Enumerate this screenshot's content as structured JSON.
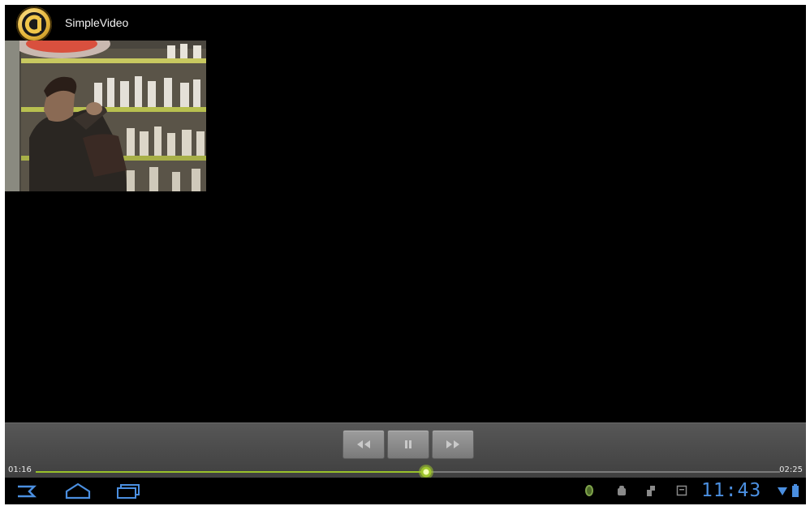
{
  "app": {
    "title": "SimpleVideo",
    "icon": "app-logo-icon"
  },
  "video": {
    "description_icon": "video-frame"
  },
  "player": {
    "current_time": "01:16",
    "total_time": "02:25",
    "progress": 0.5241,
    "buttons": [
      {
        "name": "rewind-button",
        "icon": "rewind-icon"
      },
      {
        "name": "pause-button",
        "icon": "pause-icon"
      },
      {
        "name": "fast-forward-button",
        "icon": "fast-forward-icon"
      }
    ],
    "accent_color": "#99c12a"
  },
  "system_bar": {
    "clock": "11:43",
    "nav": [
      "back-icon",
      "home-icon",
      "recent-apps-icon"
    ],
    "status": [
      "android-notification-icon",
      "debug-icon",
      "usb-icon",
      "screenshot-icon",
      "wifi-icon",
      "battery-icon"
    ],
    "accent_color": "#4b8fe0"
  }
}
